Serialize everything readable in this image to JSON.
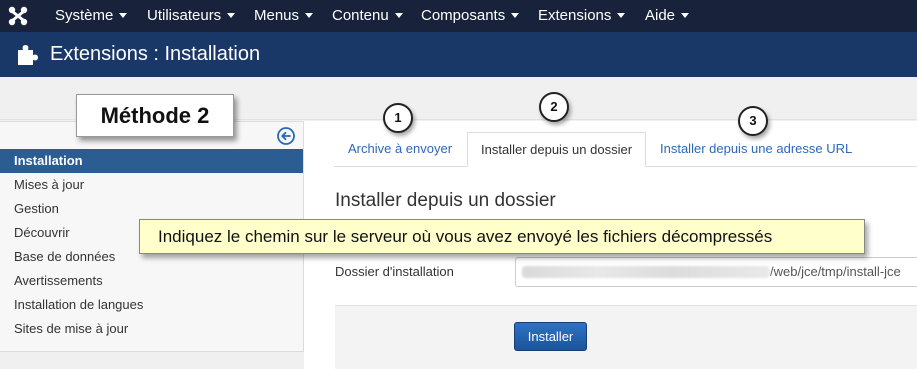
{
  "nav": {
    "items": [
      {
        "label": "Système"
      },
      {
        "label": "Utilisateurs"
      },
      {
        "label": "Menus"
      },
      {
        "label": "Contenu"
      },
      {
        "label": "Composants"
      },
      {
        "label": "Extensions"
      },
      {
        "label": "Aide"
      }
    ]
  },
  "header": {
    "title": "Extensions : Installation",
    "icon": "puzzle-icon"
  },
  "annotation": {
    "method": "Méthode 2",
    "steps": [
      "1",
      "2",
      "3"
    ],
    "tooltip": "Indiquez le chemin sur le serveur où vous avez envoyé les fichiers décompressés"
  },
  "sidebar": {
    "items": [
      {
        "label": "Installation",
        "active": true
      },
      {
        "label": "Mises à jour"
      },
      {
        "label": "Gestion"
      },
      {
        "label": "Découvrir"
      },
      {
        "label": "Base de données"
      },
      {
        "label": "Avertissements"
      },
      {
        "label": "Installation de langues"
      },
      {
        "label": "Sites de mise à jour"
      }
    ]
  },
  "tabs": [
    {
      "label": "Archive à envoyer"
    },
    {
      "label": "Installer depuis un dossier",
      "active": true
    },
    {
      "label": "Installer depuis une adresse URL"
    }
  ],
  "main": {
    "section_title": "Installer depuis un dossier",
    "field_label": "Dossier d'installation",
    "field_value_visible": "/web/jce/tmp/install-jce",
    "install_button": "Installer"
  },
  "colors": {
    "topnav": "#18223a",
    "header": "#1a3867",
    "active_sidebar": "#2b5d93",
    "link": "#2a69b8",
    "tooltip_bg": "#ffffcc"
  }
}
